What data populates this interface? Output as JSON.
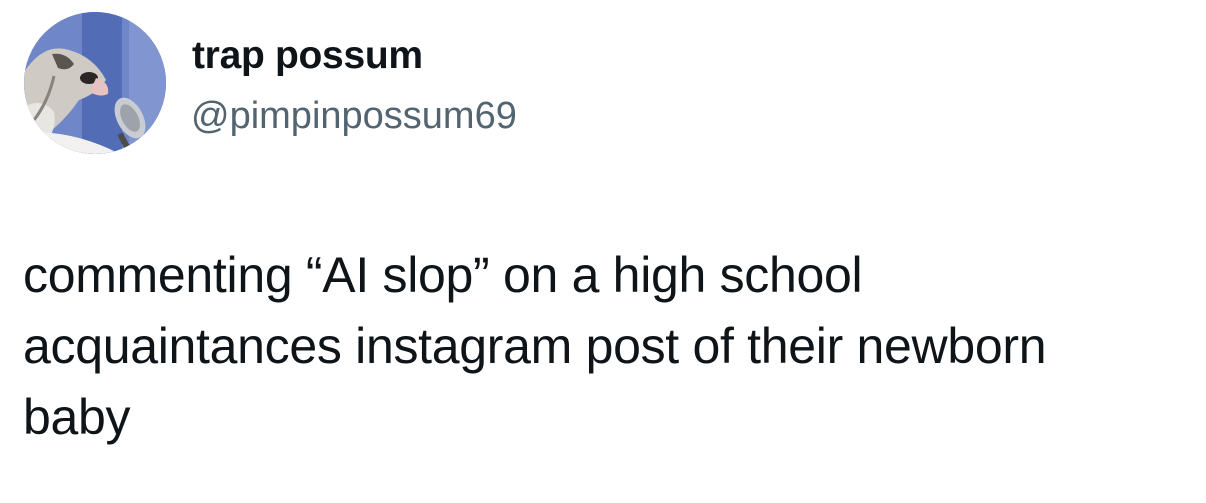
{
  "tweet": {
    "display_name": "trap possum",
    "handle": "@pimpinpossum69",
    "text": "commenting “AI slop” on a high school\nacquaintances instagram post of their newborn\nbaby",
    "avatar_icon": "possum-avatar-icon"
  },
  "colors": {
    "text_primary": "#0f1419",
    "text_secondary": "#536471",
    "background": "#ffffff",
    "avatar_bg": "#6f86c8"
  }
}
